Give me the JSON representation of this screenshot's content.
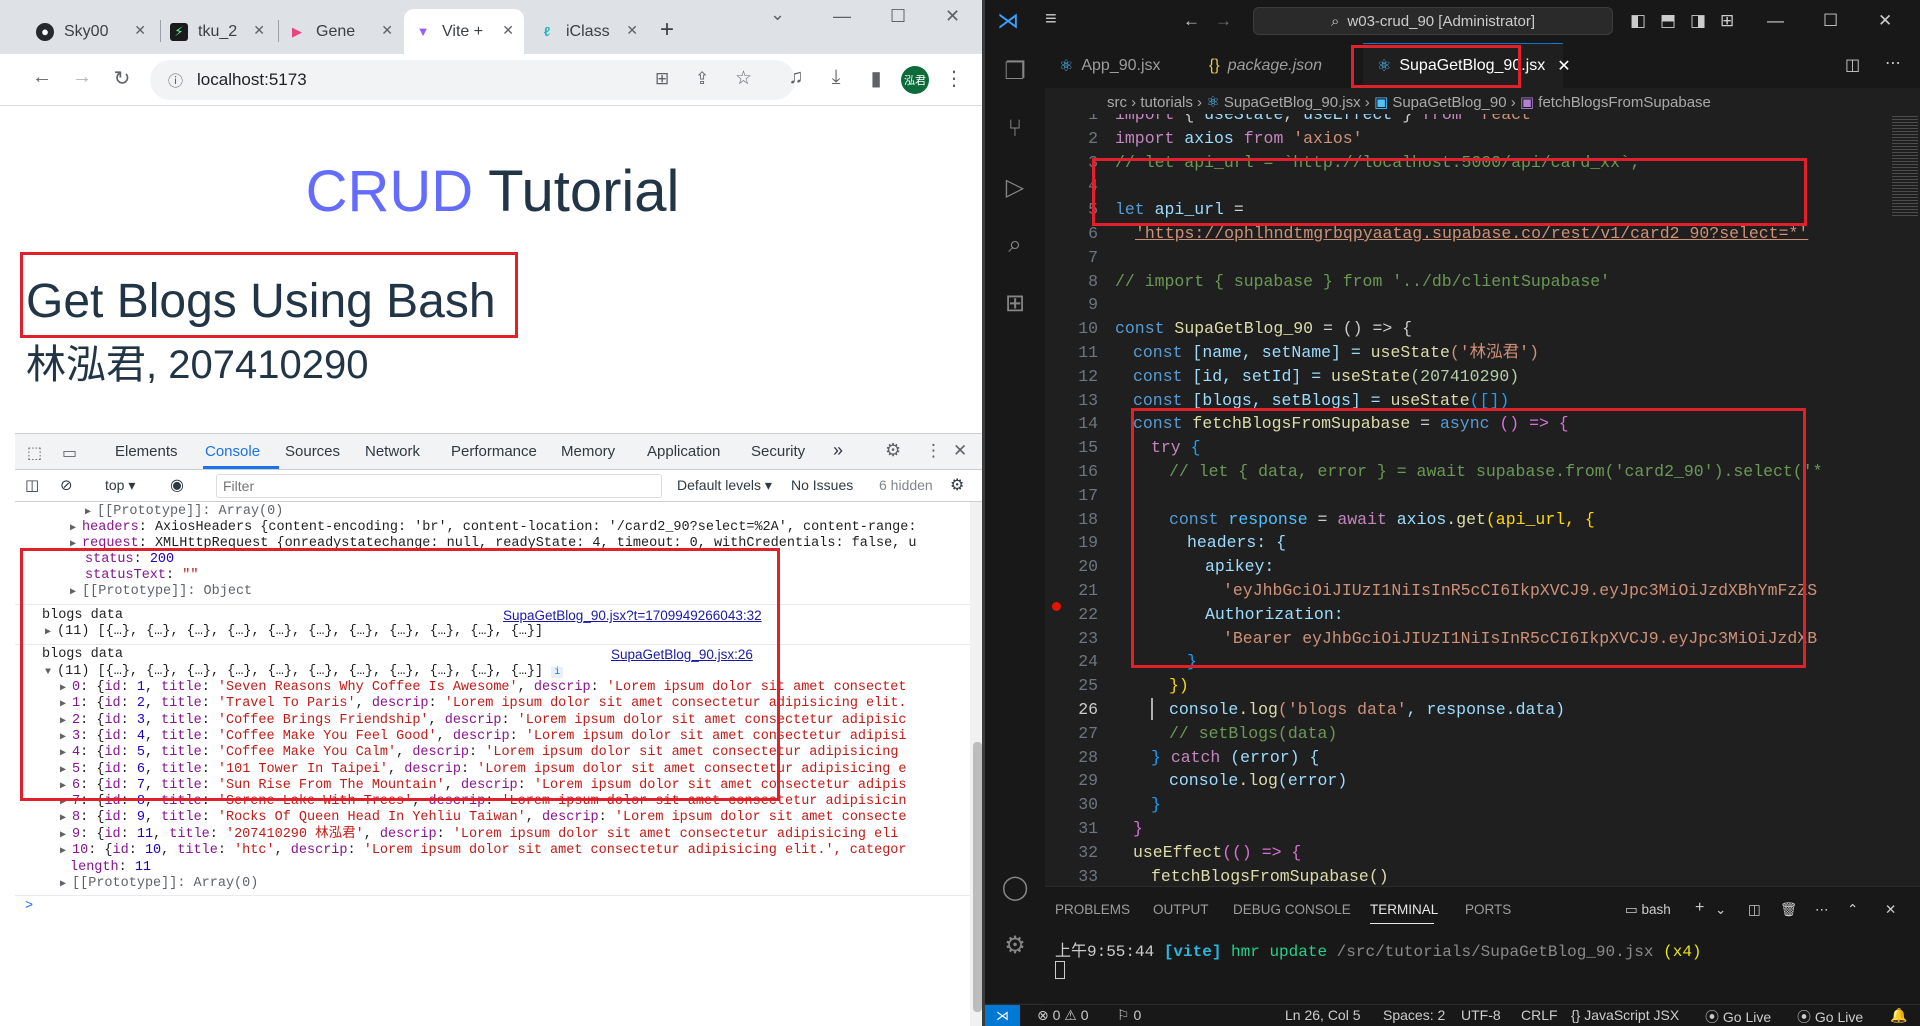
{
  "chrome": {
    "tabs": [
      {
        "label": "Sky00",
        "icon": "github-icon"
      },
      {
        "label": "tku_2",
        "icon": "ai-icon"
      },
      {
        "label": "Gene",
        "icon": "media-icon"
      },
      {
        "label": "Vite +",
        "icon": "vite-icon"
      },
      {
        "label": "iClass",
        "icon": "iclass-icon"
      }
    ],
    "new_tab": "+",
    "url": "localhost:5173",
    "avatar": "泓君"
  },
  "page": {
    "title_accent": "CRUD",
    "title_rest": " Tutorial",
    "heading": "Get Blogs Using Bash",
    "author": "林泓君, 207410290"
  },
  "devtools": {
    "tabs": [
      "Elements",
      "Console",
      "Sources",
      "Network",
      "Performance",
      "Memory",
      "Application",
      "Security"
    ],
    "more": "»",
    "context": "top",
    "filter_placeholder": "Filter",
    "levels": "Default levels",
    "issues": "No Issues",
    "hidden": "6 hidden",
    "console_lines": {
      "proto_array": "[[Prototype]]: Array(0)",
      "headers_key": "headers",
      "headers_val": ": AxiosHeaders {content-encoding: 'br', content-location: '/card2_90?select=%2A', content-range:",
      "request_key": "request",
      "request_val": ": XMLHttpRequest {onreadystatechange: null, readyState: 4, timeout: 0, withCredentials: false, u",
      "status_key": "status",
      "status_val": "200",
      "statustext_key": "statusText",
      "statustext_val": "\"\"",
      "proto_object": "[[Prototype]]: Object",
      "log1_label": "blogs data",
      "log1_link": "SupaGetBlog_90.jsx?t=1709949266043:32",
      "log1_summary": "(11) [{…}, {…}, {…}, {…}, {…}, {…}, {…}, {…}, {…}, {…}, {…}]",
      "log2_label": "blogs data",
      "log2_link": "SupaGetBlog_90.jsx:26",
      "log2_summary": "(11) [{…}, {…}, {…}, {…}, {…}, {…}, {…}, {…}, {…}, {…}, {…}]",
      "length_key": "length",
      "length_val": "11",
      "proto_array2": "[[Prototype]]: Array(0)",
      "prompt": ">"
    },
    "items": [
      {
        "idx": "0",
        "id": "1",
        "title": "'Seven Reasons Why Coffee Is Awesome'",
        "descrip": "'Lorem ipsum dolor sit amet consectet"
      },
      {
        "idx": "1",
        "id": "2",
        "title": "'Travel To Paris'",
        "descrip": "'Lorem ipsum dolor sit amet consectetur adipisicing elit."
      },
      {
        "idx": "2",
        "id": "3",
        "title": "'Coffee Brings Friendship'",
        "descrip": "'Lorem ipsum dolor sit amet consectetur adipisic"
      },
      {
        "idx": "3",
        "id": "4",
        "title": "'Coffee Make You Feel Good'",
        "descrip": "'Lorem ipsum dolor sit amet consectetur adipisi"
      },
      {
        "idx": "4",
        "id": "5",
        "title": "'Coffee Make You Calm'",
        "descrip": "'Lorem ipsum dolor sit amet consectetur adipisicing"
      },
      {
        "idx": "5",
        "id": "6",
        "title": "'101 Tower In Taipei'",
        "descrip": "'Lorem ipsum dolor sit amet consectetur adipisicing e"
      },
      {
        "idx": "6",
        "id": "7",
        "title": "'Sun Rise From The Mountain'",
        "descrip": "'Lorem ipsum dolor sit amet consectetur adipis"
      },
      {
        "idx": "7",
        "id": "8",
        "title": "'Serene Lake With Trees'",
        "descrip": "'Lorem ipsum dolor sit amet consectetur adipisicin"
      },
      {
        "idx": "8",
        "id": "9",
        "title": "'Rocks Of Queen Head In Yehliu Taiwan'",
        "descrip": "'Lorem ipsum dolor sit amet consecte"
      },
      {
        "idx": "9",
        "id": "11",
        "title": "'207410290 林泓君'",
        "descrip": "'Lorem ipsum dolor sit amet consectetur adipisicing eli"
      },
      {
        "idx": "10",
        "id": "10",
        "title": "'htc'",
        "descrip": "'Lorem ipsum dolor sit amet consectetur adipisicing elit.', categor"
      }
    ]
  },
  "vscode": {
    "search": "w03-crud_90 [Administrator]",
    "tabs": [
      {
        "label": "App_90.jsx",
        "icon": "react-icon"
      },
      {
        "label": "package.json",
        "icon": "json-icon"
      },
      {
        "label": "SupaGetBlog_90.jsx",
        "icon": "react-icon"
      }
    ],
    "breadcrumb": [
      "src",
      "tutorials",
      "SupaGetBlog_90.jsx",
      "SupaGetBlog_90",
      "fetchBlogsFromSupabase"
    ],
    "line_numbers": [
      "1",
      "2",
      "3",
      "4",
      "5",
      "6",
      "7",
      "8",
      "9",
      "10",
      "11",
      "12",
      "13",
      "14",
      "15",
      "16",
      "17",
      "18",
      "19",
      "20",
      "21",
      "22",
      "23",
      "24",
      "25",
      "26",
      "27",
      "28",
      "29",
      "30",
      "31",
      "32",
      "33"
    ],
    "code": {
      "l1_a": "import",
      "l1_b": " { ",
      "l1_c": "useState",
      "l1_d": ", ",
      "l1_e": "useEffect",
      "l1_f": " } ",
      "l1_g": "from",
      "l1_h": " 'react'",
      "l2_a": "import",
      "l2_b": " axios ",
      "l2_c": "from",
      "l2_d": " 'axios'",
      "l3": "// let api_url = `http://localhost:5000/api/card_xx`;",
      "l5_a": "let",
      "l5_b": " api_url",
      "l5_c": " =",
      "l6": "'https://ophlhndtmgrbqpyaatag.supabase.co/rest/v1/card2_90?select=*'",
      "l8": "// import { supabase } from '../db/clientSupabase'",
      "l10_a": "const",
      "l10_b": " SupaGetBlog_90",
      "l10_c": " = () => {",
      "l11_a": "const",
      "l11_b": " [name, setName] = ",
      "l11_c": "useState",
      "l11_d": "('林泓君')",
      "l12_a": "const",
      "l12_b": " [id, setId] = ",
      "l12_c": "useState",
      "l12_d": "(207410290)",
      "l13_a": "const",
      "l13_b": " [blogs, setBlogs] = ",
      "l13_c": "useState",
      "l13_d": "([])",
      "l14_a": "const",
      "l14_b": " fetchBlogsFromSupabase",
      "l14_c": " = ",
      "l14_d": "async",
      "l14_e": " () => {",
      "l15_a": "try",
      "l15_b": " {",
      "l16": "// let { data, error } = await supabase.from('card2_90').select('*",
      "l18_a": "const",
      "l18_b": " response",
      "l18_c": " = ",
      "l18_d": "await",
      "l18_e": " axios",
      "l18_f": ".get",
      "l18_g": "(api_url, {",
      "l19": "headers: {",
      "l20": "apikey:",
      "l21": "'eyJhbGciOiJIUzI1NiIsInR5cCI6IkpXVCJ9.eyJpc3MiOiJzdXBhYmFzZS",
      "l22": "Authorization:",
      "l23": "'Bearer eyJhbGciOiJIUzI1NiIsInR5cCI6IkpXVCJ9.eyJpc3MiOiJzdXB",
      "l24": "}",
      "l25": "})",
      "l26_a": "console",
      "l26_b": ".log",
      "l26_c": "('blogs data'",
      "l26_d": ", response.data)",
      "l27": "// setBlogs(data)",
      "l28_a": "} ",
      "l28_b": "catch",
      "l28_c": " (error) {",
      "l29_a": "console",
      "l29_b": ".log",
      "l29_c": "(error)",
      "l30": "}",
      "l31": "}",
      "l32_a": "useEffect",
      "l32_b": "(() => {",
      "l33": "fetchBlogsFromSupabase()"
    },
    "panel_tabs": [
      "PROBLEMS",
      "OUTPUT",
      "DEBUG CONSOLE",
      "TERMINAL",
      "PORTS"
    ],
    "terminal_shell": "bash",
    "terminal_time": "上午9:55:44",
    "terminal_tag": "[vite]",
    "terminal_msg": " hmr update ",
    "terminal_path": "/src/tutorials/SupaGetBlog_90.jsx",
    "terminal_count": "(x4)",
    "status": {
      "errors": "⊗ 0 ⚠ 0",
      "ports": "⚐ 0",
      "position": "Ln 26, Col 5",
      "spaces": "Spaces: 2",
      "encoding": "UTF-8",
      "eol": "CRLF",
      "language": "{} JavaScript JSX",
      "golive1": "Go Live",
      "golive2": "Go Live"
    }
  }
}
